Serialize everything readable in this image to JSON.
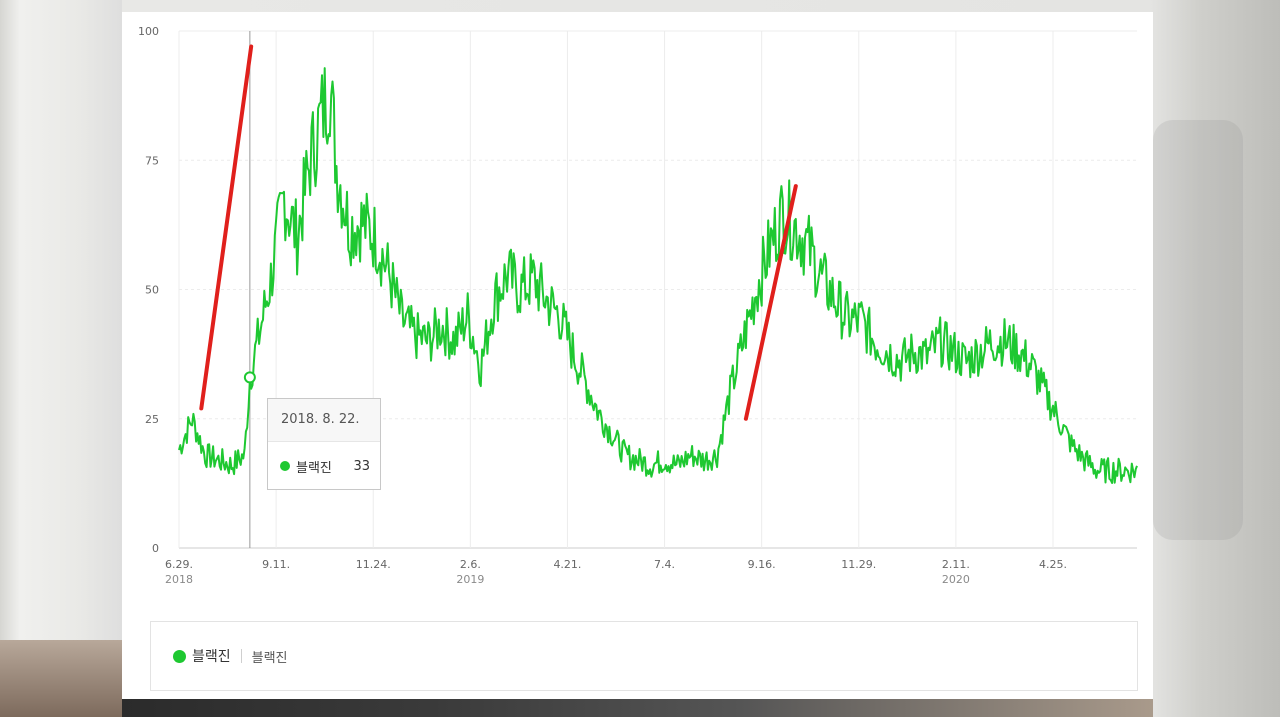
{
  "colors": {
    "series": "#1ec831",
    "trend": "#e0201c",
    "grid": "#ececec",
    "cursor": "#999999"
  },
  "tooltip": {
    "date": "2018. 8. 22.",
    "series_name": "블랙진",
    "value": "33"
  },
  "legend": {
    "series_name": "블랙진",
    "sub_label": "블랙진"
  },
  "chart_data": {
    "type": "line",
    "title": "",
    "xlabel": "",
    "ylabel": "",
    "ylim": [
      0,
      100
    ],
    "yticks": [
      0,
      25,
      50,
      75,
      100
    ],
    "x_range_days": [
      0,
      365
    ],
    "x_start_date": "2018-06-29",
    "x_end_date": "2020-06-29",
    "grid": true,
    "legend_position": "bottom",
    "xticks": [
      {
        "label": "6.29.",
        "year": "2018",
        "day": 0
      },
      {
        "label": "9.11.",
        "year": "",
        "day": 74
      },
      {
        "label": "11.24.",
        "year": "",
        "day": 148
      },
      {
        "label": "2.6.",
        "year": "2019",
        "day": 222
      },
      {
        "label": "4.21.",
        "year": "",
        "day": 296
      },
      {
        "label": "7.4.",
        "year": "",
        "day": 370
      },
      {
        "label": "9.16.",
        "year": "",
        "day": 444
      },
      {
        "label": "11.29.",
        "year": "",
        "day": 518
      },
      {
        "label": "2.11.",
        "year": "2020",
        "day": 592
      },
      {
        "label": "4.25.",
        "year": "",
        "day": 666
      }
    ],
    "series": [
      {
        "name": "블랙진",
        "x_days": [
          0,
          10,
          20,
          30,
          40,
          50,
          54,
          60,
          70,
          80,
          90,
          100,
          110,
          115,
          120,
          130,
          140,
          150,
          160,
          170,
          180,
          190,
          200,
          210,
          220,
          230,
          240,
          250,
          260,
          270,
          280,
          290,
          300,
          310,
          320,
          330,
          340,
          350,
          360,
          370,
          380,
          390,
          400,
          410,
          420,
          430,
          440,
          450,
          460,
          470,
          480,
          490,
          500,
          510,
          520,
          530,
          540,
          550,
          560,
          570,
          580,
          590,
          600,
          610,
          620,
          630,
          640,
          650,
          660,
          670,
          680,
          690,
          700,
          710,
          720,
          730
        ],
        "values": [
          19,
          25,
          18,
          17,
          16,
          18,
          33,
          40,
          52,
          68,
          60,
          75,
          85,
          90,
          74,
          62,
          63,
          60,
          53,
          44,
          41,
          40,
          43,
          40,
          45,
          35,
          48,
          53,
          50,
          52,
          48,
          45,
          38,
          32,
          26,
          22,
          18,
          17,
          16,
          17,
          16,
          18,
          17,
          18,
          30,
          40,
          50,
          58,
          65,
          62,
          58,
          52,
          48,
          44,
          44,
          40,
          38,
          36,
          38,
          37,
          40,
          38,
          36,
          38,
          40,
          40,
          38,
          35,
          30,
          25,
          20,
          17,
          15,
          15,
          15,
          15
        ]
      }
    ],
    "annotations": [
      {
        "type": "trend-line",
        "from": {
          "day": 17,
          "value": 27
        },
        "to": {
          "day": 55,
          "value": 97
        }
      },
      {
        "type": "trend-line",
        "from": {
          "day": 432,
          "value": 25
        },
        "to": {
          "day": 470,
          "value": 70
        }
      },
      {
        "type": "hover-marker",
        "day": 54,
        "value": 33
      }
    ]
  }
}
